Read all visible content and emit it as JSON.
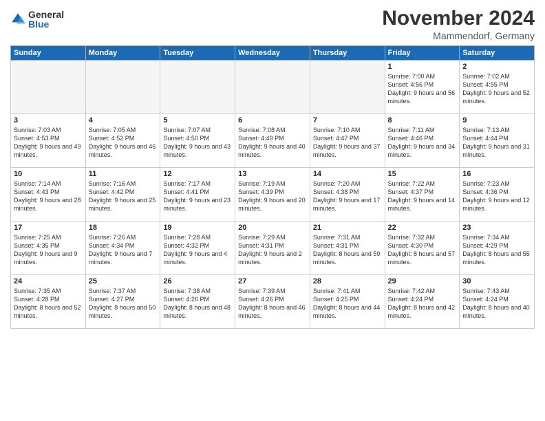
{
  "logo": {
    "general": "General",
    "blue": "Blue"
  },
  "title": "November 2024",
  "location": "Mammendorf, Germany",
  "headers": [
    "Sunday",
    "Monday",
    "Tuesday",
    "Wednesday",
    "Thursday",
    "Friday",
    "Saturday"
  ],
  "weeks": [
    [
      {
        "day": "",
        "info": ""
      },
      {
        "day": "",
        "info": ""
      },
      {
        "day": "",
        "info": ""
      },
      {
        "day": "",
        "info": ""
      },
      {
        "day": "",
        "info": ""
      },
      {
        "day": "1",
        "info": "Sunrise: 7:00 AM\nSunset: 4:56 PM\nDaylight: 9 hours and 56 minutes."
      },
      {
        "day": "2",
        "info": "Sunrise: 7:02 AM\nSunset: 4:55 PM\nDaylight: 9 hours and 52 minutes."
      }
    ],
    [
      {
        "day": "3",
        "info": "Sunrise: 7:03 AM\nSunset: 4:53 PM\nDaylight: 9 hours and 49 minutes."
      },
      {
        "day": "4",
        "info": "Sunrise: 7:05 AM\nSunset: 4:52 PM\nDaylight: 9 hours and 46 minutes."
      },
      {
        "day": "5",
        "info": "Sunrise: 7:07 AM\nSunset: 4:50 PM\nDaylight: 9 hours and 43 minutes."
      },
      {
        "day": "6",
        "info": "Sunrise: 7:08 AM\nSunset: 4:49 PM\nDaylight: 9 hours and 40 minutes."
      },
      {
        "day": "7",
        "info": "Sunrise: 7:10 AM\nSunset: 4:47 PM\nDaylight: 9 hours and 37 minutes."
      },
      {
        "day": "8",
        "info": "Sunrise: 7:11 AM\nSunset: 4:46 PM\nDaylight: 9 hours and 34 minutes."
      },
      {
        "day": "9",
        "info": "Sunrise: 7:13 AM\nSunset: 4:44 PM\nDaylight: 9 hours and 31 minutes."
      }
    ],
    [
      {
        "day": "10",
        "info": "Sunrise: 7:14 AM\nSunset: 4:43 PM\nDaylight: 9 hours and 28 minutes."
      },
      {
        "day": "11",
        "info": "Sunrise: 7:16 AM\nSunset: 4:42 PM\nDaylight: 9 hours and 25 minutes."
      },
      {
        "day": "12",
        "info": "Sunrise: 7:17 AM\nSunset: 4:41 PM\nDaylight: 9 hours and 23 minutes."
      },
      {
        "day": "13",
        "info": "Sunrise: 7:19 AM\nSunset: 4:39 PM\nDaylight: 9 hours and 20 minutes."
      },
      {
        "day": "14",
        "info": "Sunrise: 7:20 AM\nSunset: 4:38 PM\nDaylight: 9 hours and 17 minutes."
      },
      {
        "day": "15",
        "info": "Sunrise: 7:22 AM\nSunset: 4:37 PM\nDaylight: 9 hours and 14 minutes."
      },
      {
        "day": "16",
        "info": "Sunrise: 7:23 AM\nSunset: 4:36 PM\nDaylight: 9 hours and 12 minutes."
      }
    ],
    [
      {
        "day": "17",
        "info": "Sunrise: 7:25 AM\nSunset: 4:35 PM\nDaylight: 9 hours and 9 minutes."
      },
      {
        "day": "18",
        "info": "Sunrise: 7:26 AM\nSunset: 4:34 PM\nDaylight: 9 hours and 7 minutes."
      },
      {
        "day": "19",
        "info": "Sunrise: 7:28 AM\nSunset: 4:32 PM\nDaylight: 9 hours and 4 minutes."
      },
      {
        "day": "20",
        "info": "Sunrise: 7:29 AM\nSunset: 4:31 PM\nDaylight: 9 hours and 2 minutes."
      },
      {
        "day": "21",
        "info": "Sunrise: 7:31 AM\nSunset: 4:31 PM\nDaylight: 8 hours and 59 minutes."
      },
      {
        "day": "22",
        "info": "Sunrise: 7:32 AM\nSunset: 4:30 PM\nDaylight: 8 hours and 57 minutes."
      },
      {
        "day": "23",
        "info": "Sunrise: 7:34 AM\nSunset: 4:29 PM\nDaylight: 8 hours and 55 minutes."
      }
    ],
    [
      {
        "day": "24",
        "info": "Sunrise: 7:35 AM\nSunset: 4:28 PM\nDaylight: 8 hours and 52 minutes."
      },
      {
        "day": "25",
        "info": "Sunrise: 7:37 AM\nSunset: 4:27 PM\nDaylight: 8 hours and 50 minutes."
      },
      {
        "day": "26",
        "info": "Sunrise: 7:38 AM\nSunset: 4:26 PM\nDaylight: 8 hours and 48 minutes."
      },
      {
        "day": "27",
        "info": "Sunrise: 7:39 AM\nSunset: 4:26 PM\nDaylight: 8 hours and 46 minutes."
      },
      {
        "day": "28",
        "info": "Sunrise: 7:41 AM\nSunset: 4:25 PM\nDaylight: 8 hours and 44 minutes."
      },
      {
        "day": "29",
        "info": "Sunrise: 7:42 AM\nSunset: 4:24 PM\nDaylight: 8 hours and 42 minutes."
      },
      {
        "day": "30",
        "info": "Sunrise: 7:43 AM\nSunset: 4:24 PM\nDaylight: 8 hours and 40 minutes."
      }
    ]
  ]
}
